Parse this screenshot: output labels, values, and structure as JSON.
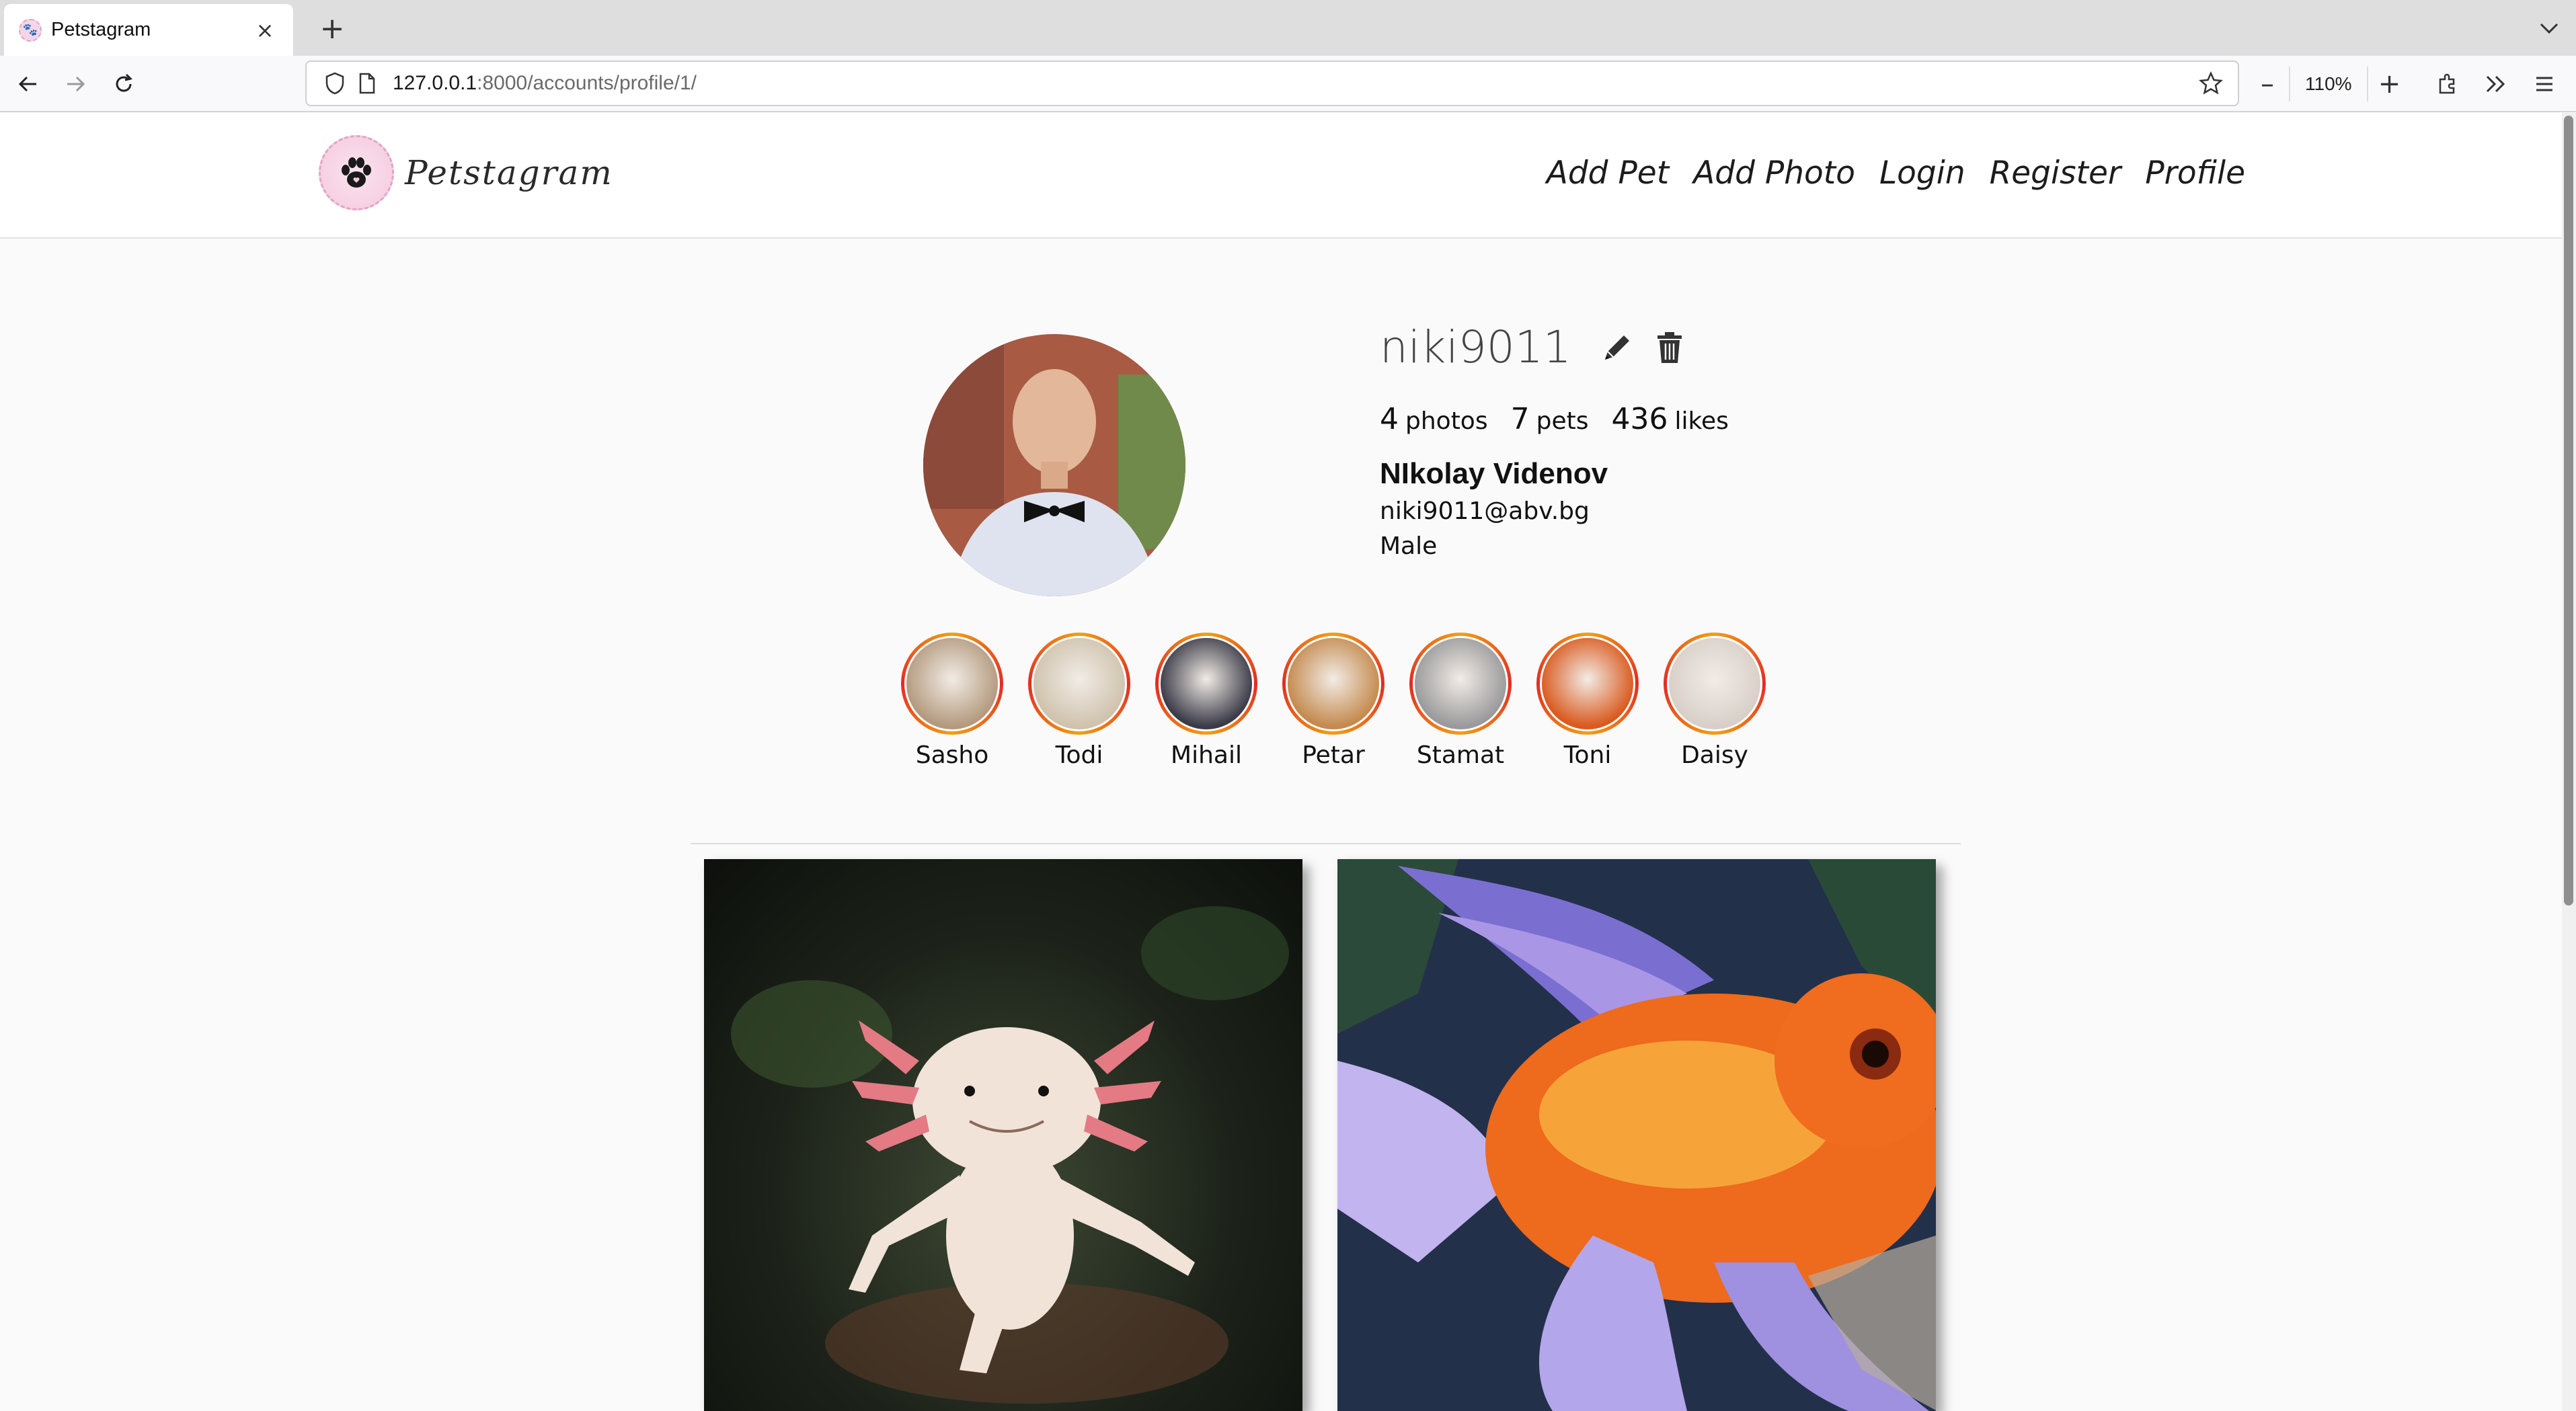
{
  "browser": {
    "tab_title": "Petstagram",
    "tab_close": "×",
    "new_tab": "+",
    "url_host": "127.0.0.1",
    "url_rest": ":8000/accounts/profile/1/",
    "zoom_out": "–",
    "zoom_level": "110%",
    "zoom_in": "+"
  },
  "site": {
    "brand": "Petstagram",
    "nav": {
      "add_pet": "Add Pet",
      "add_photo": "Add Photo",
      "login": "Login",
      "register": "Register",
      "profile": "Profile"
    }
  },
  "profile": {
    "username": "niki9011",
    "photos_count": "4",
    "photos_label": "photos",
    "pets_count": "7",
    "pets_label": "pets",
    "likes_count": "436",
    "likes_label": "likes",
    "full_name": "NIkolay Videnov",
    "email": "niki9011@abv.bg",
    "gender": "Male"
  },
  "pets": [
    {
      "name": "Sasho",
      "color": "#b39a7e"
    },
    {
      "name": "Todi",
      "color": "#cfc3ad"
    },
    {
      "name": "Mihail",
      "color": "#3b3b48"
    },
    {
      "name": "Petar",
      "color": "#c48a4e"
    },
    {
      "name": "Stamat",
      "color": "#9a9a9c"
    },
    {
      "name": "Toni",
      "color": "#d95a1e"
    },
    {
      "name": "Daisy",
      "color": "#d8cfc8"
    }
  ],
  "colors": {
    "accent_ring_a": "#f1a013",
    "accent_ring_b": "#e22b25"
  }
}
